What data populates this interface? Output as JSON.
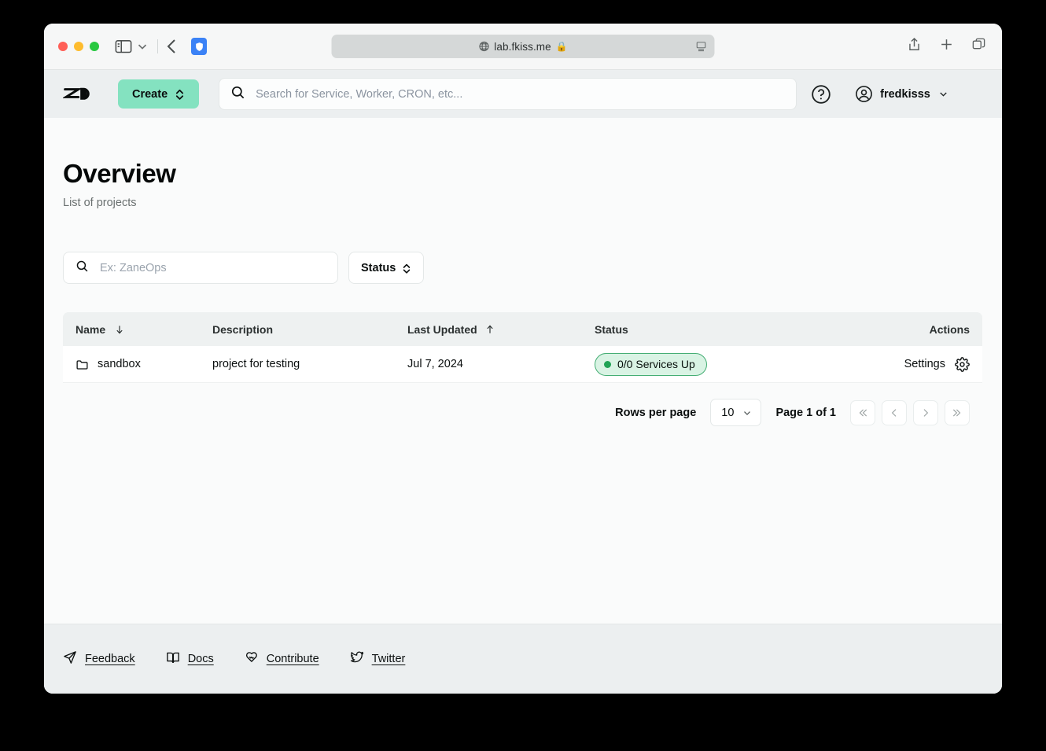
{
  "browser": {
    "url": "lab.fkiss.me",
    "globe_icon": "globe-icon",
    "lock_icon": "lock-icon",
    "traffic_lights": [
      "close",
      "minimize",
      "maximize"
    ],
    "toolbar_icons": [
      "sidebar-toggle-icon",
      "chevron-down-icon",
      "back-icon",
      "shield-extension-icon"
    ],
    "right_icons": [
      "share-icon",
      "new-tab-icon",
      "tabs-overview-icon"
    ]
  },
  "header": {
    "logo_label": "ZaneOps",
    "create_label": "Create",
    "search_placeholder": "Search for Service, Worker, CRON, etc...",
    "search_value": "",
    "help_icon": "help-circle-icon",
    "username": "fredkisss",
    "avatar_icon": "user-circle-icon",
    "chevron_icon": "chevron-down-icon",
    "accent_color": "#84e2c0",
    "background": "#eceff0"
  },
  "main": {
    "title": "Overview",
    "subtitle": "List of projects",
    "filter_placeholder": "Ex: ZaneOps",
    "filter_value": "",
    "status_filter_label": "Status"
  },
  "table": {
    "columns": [
      {
        "label": "Name",
        "sort": "desc",
        "sort_glyph": "arrow-down-icon"
      },
      {
        "label": "Description",
        "sort": "none",
        "sort_glyph": ""
      },
      {
        "label": "Last Updated",
        "sort": "asc",
        "sort_glyph": "arrow-up-icon"
      },
      {
        "label": "Status",
        "sort": "none",
        "sort_glyph": ""
      },
      {
        "label": "Actions",
        "sort": "none",
        "sort_glyph": ""
      }
    ],
    "rows": [
      {
        "icon": "folder-icon",
        "name": "sandbox",
        "description": "project for testing",
        "last_updated": "Jul 7, 2024",
        "status_text": "0/0 Services Up",
        "status_color": "#21a355",
        "status_bg": "#d9f3e4",
        "status_border": "#45ae74",
        "action_label": "Settings",
        "action_icon": "gear-icon"
      }
    ]
  },
  "pagination": {
    "rows_per_page_label": "Rows per page",
    "rows_per_page_value": "10",
    "page_indicator": "Page 1 of 1",
    "first_label": "«",
    "prev_label": "‹",
    "next_label": "›",
    "last_label": "»"
  },
  "footer": {
    "links": [
      {
        "label": "Feedback",
        "icon": "send-icon"
      },
      {
        "label": "Docs",
        "icon": "book-icon"
      },
      {
        "label": "Contribute",
        "icon": "heart-handshake-icon"
      },
      {
        "label": "Twitter",
        "icon": "twitter-bird-icon"
      }
    ]
  }
}
